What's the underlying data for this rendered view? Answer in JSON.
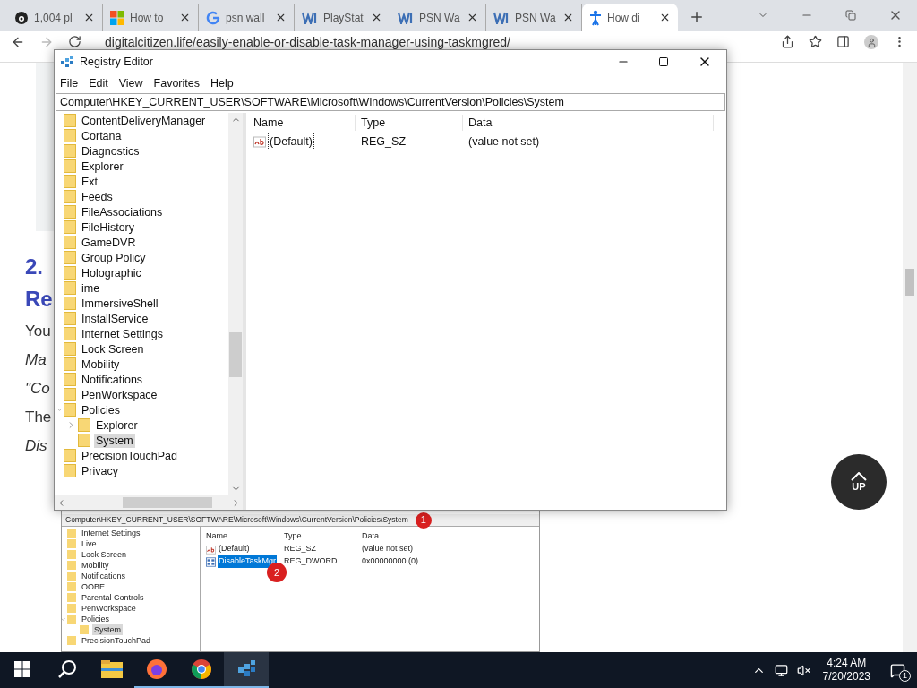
{
  "browser": {
    "tabs": [
      {
        "label": "1,004 pl",
        "kind": "eye",
        "selected": false
      },
      {
        "label": "How to",
        "kind": "windows",
        "selected": false
      },
      {
        "label": "psn wall",
        "kind": "google",
        "selected": false
      },
      {
        "label": "PlayStat",
        "kind": "w",
        "selected": false
      },
      {
        "label": "PSN Wa",
        "kind": "w",
        "selected": false
      },
      {
        "label": "PSN Wa",
        "kind": "w",
        "selected": false
      },
      {
        "label": "How di",
        "kind": "person",
        "selected": true
      }
    ],
    "url": "digitalcitizen.life/easily-enable-or-disable-task-manager-using-taskmgred/"
  },
  "article": {
    "heading": [
      "2.",
      "Re"
    ],
    "lines": [
      {
        "text": "You",
        "italic": false
      },
      {
        "text": "Ma",
        "italic": true
      },
      {
        "text": "\"Co",
        "italic": true
      },
      {
        "text": "The",
        "italic": false
      },
      {
        "text": "Dis",
        "italic": true
      }
    ]
  },
  "registry": {
    "title": "Registry Editor",
    "menu": [
      "File",
      "Edit",
      "View",
      "Favorites",
      "Help"
    ],
    "path": "Computer\\HKEY_CURRENT_USER\\SOFTWARE\\Microsoft\\Windows\\CurrentVersion\\Policies\\System",
    "tree": [
      {
        "label": "ContentDeliveryManager",
        "selected": false
      },
      {
        "label": "Cortana",
        "selected": false
      },
      {
        "label": "Diagnostics",
        "selected": false
      },
      {
        "label": "Explorer",
        "selected": false
      },
      {
        "label": "Ext",
        "selected": false
      },
      {
        "label": "Feeds",
        "selected": false
      },
      {
        "label": "FileAssociations",
        "selected": false
      },
      {
        "label": "FileHistory",
        "selected": false
      },
      {
        "label": "GameDVR",
        "selected": false
      },
      {
        "label": "Group Policy",
        "selected": false
      },
      {
        "label": "Holographic",
        "selected": false
      },
      {
        "label": "ime",
        "selected": false
      },
      {
        "label": "ImmersiveShell",
        "selected": false
      },
      {
        "label": "InstallService",
        "selected": false
      },
      {
        "label": "Internet Settings",
        "selected": false
      },
      {
        "label": "Lock Screen",
        "selected": false
      },
      {
        "label": "Mobility",
        "selected": false
      },
      {
        "label": "Notifications",
        "selected": false
      },
      {
        "label": "PenWorkspace",
        "selected": false
      },
      {
        "label": "Policies",
        "selected": false,
        "expanded": true,
        "children": [
          {
            "label": "Explorer",
            "selected": false,
            "expanded": false
          },
          {
            "label": "System",
            "selected": true
          }
        ]
      },
      {
        "label": "PrecisionTouchPad",
        "selected": false
      },
      {
        "label": "Privacy",
        "selected": false
      }
    ],
    "columns": [
      "Name",
      "Type",
      "Data"
    ],
    "values": [
      {
        "name": "(Default)",
        "type": "REG_SZ",
        "data": "(value not set)",
        "kind": "string",
        "selected": false
      }
    ]
  },
  "screenshot": {
    "path": "Computer\\HKEY_CURRENT_USER\\SOFTWARE\\Microsoft\\Windows\\CurrentVersion\\Policies\\System",
    "tree": [
      {
        "label": "Internet Settings",
        "selected": false
      },
      {
        "label": "Live",
        "selected": false
      },
      {
        "label": "Lock Screen",
        "selected": false
      },
      {
        "label": "Mobility",
        "selected": false
      },
      {
        "label": "Notifications",
        "selected": false
      },
      {
        "label": "OOBE",
        "selected": false
      },
      {
        "label": "Parental Controls",
        "selected": false
      },
      {
        "label": "PenWorkspace",
        "selected": false
      },
      {
        "label": "Policies",
        "selected": false,
        "expanded": true,
        "children": [
          {
            "label": "System",
            "selected": true
          }
        ]
      },
      {
        "label": "PrecisionTouchPad",
        "selected": false
      }
    ],
    "columns": [
      "Name",
      "Type",
      "Data"
    ],
    "values": [
      {
        "name": "(Default)",
        "type": "REG_SZ",
        "data": "(value not set)",
        "kind": "string",
        "selected": false
      },
      {
        "name": "DisableTaskMgr",
        "type": "REG_DWORD",
        "data": "0x00000000 (0)",
        "kind": "dword",
        "selected": true
      }
    ],
    "badges": [
      "1",
      "2"
    ]
  },
  "up_button": {
    "label": "UP"
  },
  "taskbar": {
    "apps": [
      {
        "kind": "start",
        "running": false
      },
      {
        "kind": "search",
        "running": false
      },
      {
        "kind": "folder",
        "running": false
      },
      {
        "kind": "firefox",
        "running": true
      },
      {
        "kind": "chrome",
        "running": true
      },
      {
        "kind": "regedit",
        "running": true
      }
    ],
    "time": "4:24 AM",
    "date": "7/20/2023",
    "notifications": "1"
  }
}
